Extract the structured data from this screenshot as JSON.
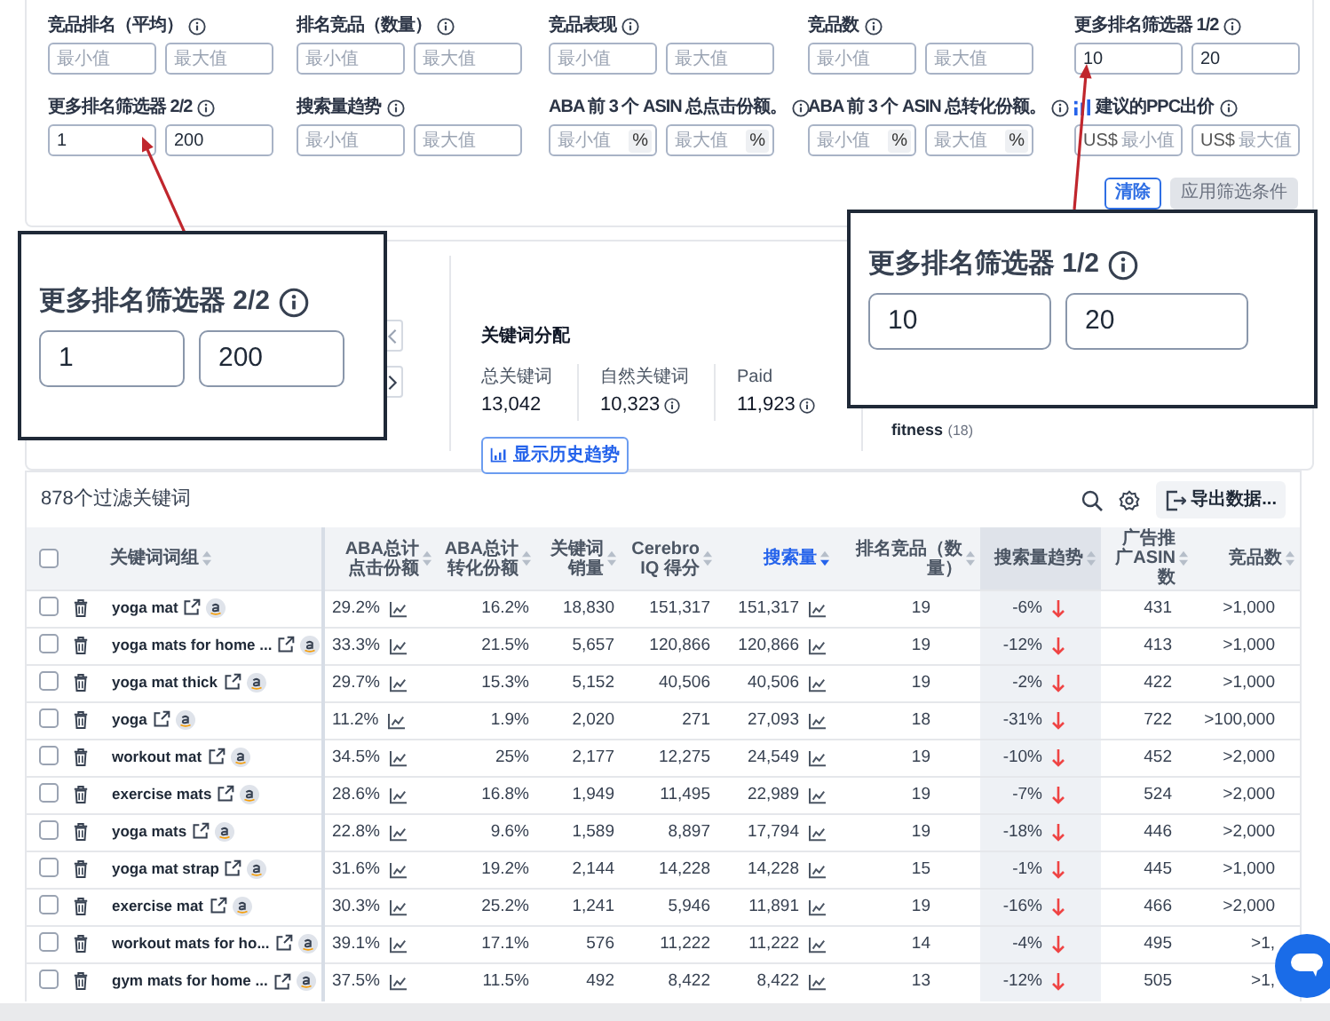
{
  "filters": [
    {
      "label": "竞品排名（平均）",
      "kind": "plain",
      "inputs": [
        {
          "placeholder": "最小值"
        },
        {
          "placeholder": "最大值"
        }
      ]
    },
    {
      "label": "排名竞品（数量）",
      "kind": "plain",
      "inputs": [
        {
          "placeholder": "最小值"
        },
        {
          "placeholder": "最大值"
        }
      ]
    },
    {
      "label": "竞品表现",
      "kind": "plain",
      "inputs": [
        {
          "placeholder": "最小值"
        },
        {
          "placeholder": "最大值"
        }
      ]
    },
    {
      "label": "竞品数",
      "kind": "plain",
      "inputs": [
        {
          "placeholder": "最小值"
        },
        {
          "placeholder": "最大值"
        }
      ]
    },
    {
      "label": "更多排名筛选器 1/2",
      "kind": "plain",
      "inputs": [
        {
          "value": "10"
        },
        {
          "value": "20"
        }
      ]
    },
    {
      "label": "更多排名筛选器 2/2",
      "kind": "plain",
      "inputs": [
        {
          "value": "1"
        },
        {
          "value": "200"
        }
      ]
    },
    {
      "label": "搜索量趋势",
      "kind": "plain",
      "inputs": [
        {
          "placeholder": "最小值"
        },
        {
          "placeholder": "最大值"
        }
      ]
    },
    {
      "label": "ABA 前 3 个 ASIN 总点击份额。",
      "kind": "plain",
      "inputs": [
        {
          "placeholder": "最小值",
          "suffix": "%"
        },
        {
          "placeholder": "最大值",
          "suffix": "%"
        }
      ]
    },
    {
      "label": "ABA 前 3 个 ASIN 总转化份额。",
      "kind": "plain",
      "inputs": [
        {
          "placeholder": "最小值",
          "suffix": "%"
        },
        {
          "placeholder": "最大值",
          "suffix": "%"
        }
      ]
    },
    {
      "label": "建议的PPC出价",
      "kind": "chart-labeled",
      "inputs": [
        {
          "placeholder": "最小值",
          "prefix": "US$"
        },
        {
          "placeholder": "最大值",
          "prefix": "US$"
        }
      ]
    }
  ],
  "filter_buttons": [
    {
      "label": "清除",
      "disabled": false
    },
    {
      "label": "应用筛选条件",
      "disabled": true
    }
  ],
  "distribution": {
    "title": "关键词分配",
    "stats": [
      {
        "label": "总关键词",
        "value": "13,042",
        "info": false
      },
      {
        "label": "自然关键词",
        "value": "10,323",
        "info": true
      },
      {
        "label": "Paid",
        "value": "11,923",
        "info": true
      }
    ],
    "button": "显示历史趋势",
    "cloud": [
      {
        "word": "fitness",
        "count": "(18)"
      }
    ]
  },
  "table": {
    "title": "878个过滤关键词",
    "export": "导出数据...",
    "select_all_checked": false,
    "columns": [
      {
        "label": "关键词词组",
        "sorted": false,
        "highlighted": false
      },
      {
        "label": "ABA总计点击份额",
        "sorted": false,
        "highlighted": false
      },
      {
        "label": "ABA总计转化份额",
        "sorted": false,
        "highlighted": false
      },
      {
        "label": "关键词销量",
        "sorted": false,
        "highlighted": false
      },
      {
        "label": "Cerebro IQ 得分",
        "sorted": false,
        "highlighted": false
      },
      {
        "label": "搜索量",
        "sorted": true,
        "highlighted": false
      },
      {
        "label": "排名竞品（数量）",
        "sorted": false,
        "highlighted": false
      },
      {
        "label": "搜索量趋势",
        "sorted": false,
        "highlighted": true
      },
      {
        "label": "广告推广ASIN数",
        "sorted": false,
        "highlighted": false
      },
      {
        "label": "竞品数",
        "sorted": false,
        "highlighted": false
      }
    ],
    "rows": [
      {
        "checked": false,
        "cells": [
          "yoga mat",
          "29.2%",
          "16.2%",
          "18,830",
          "151,317",
          "151,317",
          "19",
          "-6%",
          "431",
          ">1,000"
        ]
      },
      {
        "checked": false,
        "cells": [
          "yoga mats for home ...",
          "33.3%",
          "21.5%",
          "5,657",
          "120,866",
          "120,866",
          "19",
          "-12%",
          "413",
          ">1,000"
        ]
      },
      {
        "checked": false,
        "cells": [
          "yoga mat thick",
          "29.7%",
          "15.3%",
          "5,152",
          "40,506",
          "40,506",
          "19",
          "-2%",
          "422",
          ">1,000"
        ]
      },
      {
        "checked": false,
        "cells": [
          "yoga",
          "11.2%",
          "1.9%",
          "2,020",
          "271",
          "27,093",
          "18",
          "-31%",
          "722",
          ">100,000"
        ]
      },
      {
        "checked": false,
        "cells": [
          "workout mat",
          "34.5%",
          "25%",
          "2,177",
          "12,275",
          "24,549",
          "19",
          "-10%",
          "452",
          ">2,000"
        ]
      },
      {
        "checked": false,
        "cells": [
          "exercise mats",
          "28.6%",
          "16.8%",
          "1,949",
          "11,495",
          "22,989",
          "19",
          "-7%",
          "524",
          ">2,000"
        ]
      },
      {
        "checked": false,
        "cells": [
          "yoga mats",
          "22.8%",
          "9.6%",
          "1,589",
          "8,897",
          "17,794",
          "19",
          "-18%",
          "446",
          ">2,000"
        ]
      },
      {
        "checked": false,
        "cells": [
          "yoga mat strap",
          "31.6%",
          "19.2%",
          "2,144",
          "14,228",
          "14,228",
          "15",
          "-1%",
          "445",
          ">1,000"
        ]
      },
      {
        "checked": false,
        "cells": [
          "exercise mat",
          "30.3%",
          "25.2%",
          "1,241",
          "5,946",
          "11,891",
          "19",
          "-16%",
          "466",
          ">2,000"
        ]
      },
      {
        "checked": false,
        "cells": [
          "workout mats for ho...",
          "39.1%",
          "17.1%",
          "576",
          "11,222",
          "11,222",
          "14",
          "-4%",
          "495",
          ">1,"
        ]
      },
      {
        "checked": false,
        "cells": [
          "gym mats for home ...",
          "37.5%",
          "11.5%",
          "492",
          "8,422",
          "8,422",
          "13",
          "-12%",
          "505",
          ">1,"
        ]
      }
    ]
  },
  "callouts": [
    {
      "label": "更多排名筛选器 1/2",
      "values": [
        "10",
        "20"
      ]
    },
    {
      "label": "更多排名筛选器 2/2",
      "values": [
        "1",
        "200"
      ]
    }
  ]
}
